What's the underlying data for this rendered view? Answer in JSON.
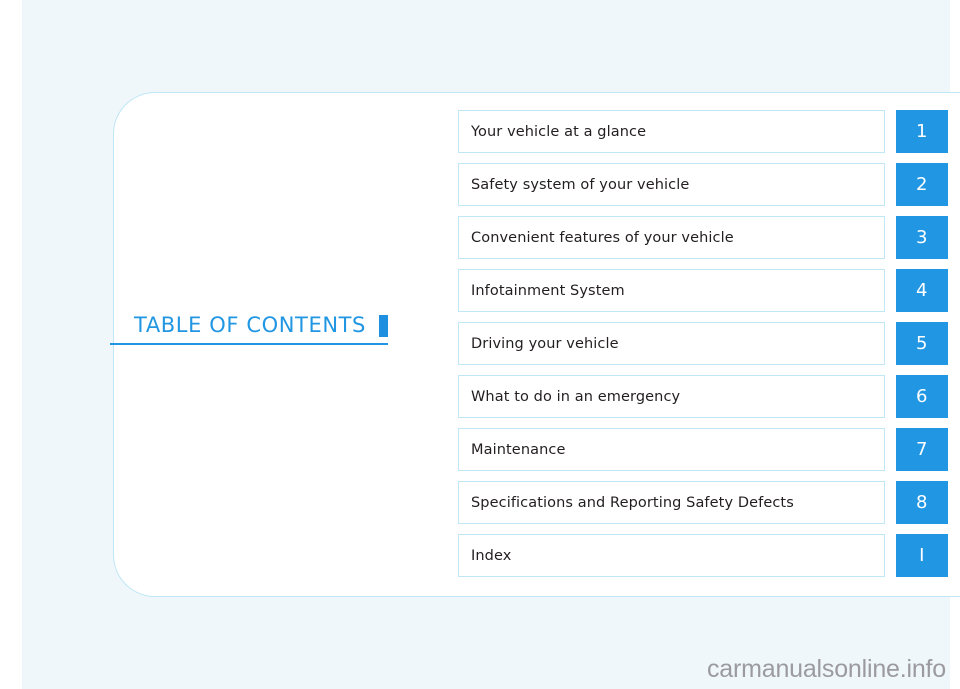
{
  "page": {
    "background_color": "#eff7fb",
    "card_background_color": "#ffffff",
    "accent_color": "#2196e3",
    "border_color": "#bfe7f5"
  },
  "heading": {
    "title": "TABLE OF CONTENTS"
  },
  "contents": {
    "rows": [
      {
        "label": "Your vehicle at a glance",
        "number": "1"
      },
      {
        "label": "Safety system of your vehicle",
        "number": "2"
      },
      {
        "label": "Convenient features of your vehicle",
        "number": "3"
      },
      {
        "label": "Infotainment System",
        "number": "4"
      },
      {
        "label": "Driving your vehicle",
        "number": "5"
      },
      {
        "label": "What to do in an emergency",
        "number": "6"
      },
      {
        "label": "Maintenance",
        "number": "7"
      },
      {
        "label": "Specifications and Reporting Safety Defects",
        "number": "8"
      },
      {
        "label": "Index",
        "number": "I"
      }
    ]
  },
  "watermark": {
    "text": "carmanualsonline.info"
  }
}
